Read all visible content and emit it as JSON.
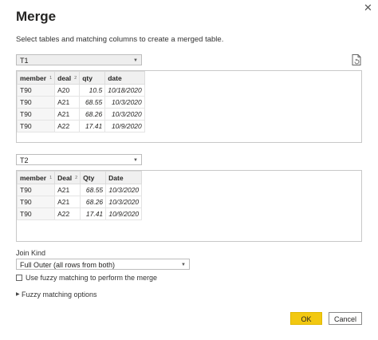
{
  "dialog": {
    "title": "Merge",
    "subtitle": "Select tables and matching columns to create a merged table."
  },
  "table1": {
    "selected": "T1",
    "columns": [
      {
        "label": "member",
        "sort": "1"
      },
      {
        "label": "deal",
        "sort": "2"
      },
      {
        "label": "qty",
        "sort": ""
      },
      {
        "label": "date",
        "sort": ""
      }
    ],
    "rows": [
      [
        "T90",
        "A20",
        "10.5",
        "10/18/2020"
      ],
      [
        "T90",
        "A21",
        "68.55",
        "10/3/2020"
      ],
      [
        "T90",
        "A21",
        "68.26",
        "10/3/2020"
      ],
      [
        "T90",
        "A22",
        "17.41",
        "10/9/2020"
      ]
    ]
  },
  "table2": {
    "selected": "T2",
    "columns": [
      {
        "label": "member",
        "sort": "1"
      },
      {
        "label": "Deal",
        "sort": "2"
      },
      {
        "label": "Qty",
        "sort": ""
      },
      {
        "label": "Date",
        "sort": ""
      }
    ],
    "rows": [
      [
        "T90",
        "A21",
        "68.55",
        "10/3/2020"
      ],
      [
        "T90",
        "A21",
        "68.26",
        "10/3/2020"
      ],
      [
        "T90",
        "A22",
        "17.41",
        "10/9/2020"
      ]
    ]
  },
  "join": {
    "label": "Join Kind",
    "selected": "Full Outer (all rows from both)"
  },
  "fuzzy": {
    "checkbox_label": "Use fuzzy matching to perform the merge",
    "checked": false,
    "options_label": "Fuzzy matching options"
  },
  "buttons": {
    "ok": "OK",
    "cancel": "Cancel"
  },
  "icons": {
    "close": "close-icon",
    "file": "file-refresh-icon",
    "dropdown": "chevron-down-icon",
    "expander": "triangle-right-icon"
  },
  "colors": {
    "ok_button": "#f2c811",
    "header_bg": "#f0f0f0",
    "select_gray": "#eeeeee"
  }
}
